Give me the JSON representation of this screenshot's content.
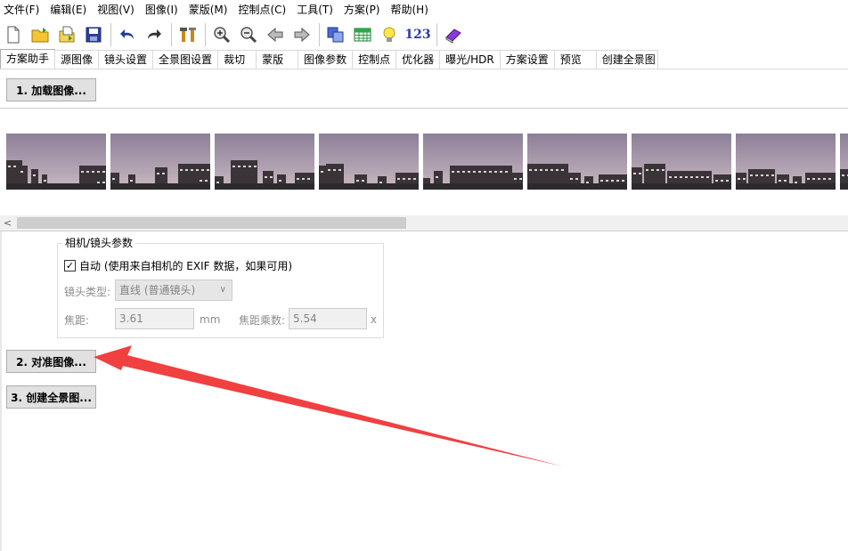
{
  "menubar": {
    "items": [
      "文件(F)",
      "编辑(E)",
      "视图(V)",
      "图像(I)",
      "蒙版(M)",
      "控制点(C)",
      "工具(T)",
      "方案(P)",
      "帮助(H)"
    ]
  },
  "toolbar": {
    "icons": [
      "new-file-icon",
      "open-folder-icon",
      "open-recent-icon",
      "save-icon",
      "undo-icon",
      "redo-icon",
      "tools-icon",
      "zoom-in-icon",
      "zoom-out-icon",
      "arrow-left-icon",
      "arrow-right-icon",
      "layers-icon",
      "table-icon",
      "bulb-icon",
      "numbers-icon",
      "book-icon"
    ],
    "numbers_label": "123"
  },
  "tabs": [
    "方案助手",
    "源图像",
    "镜头设置",
    "全景图设置",
    "裁切",
    "蒙版",
    "图像参数",
    "控制点",
    "优化器",
    "曝光/HDR",
    "方案设置",
    "预览",
    "创建全景图"
  ],
  "buttons": {
    "load": "1. 加载图像...",
    "align": "2. 对准图像...",
    "create": "3. 创建全景图..."
  },
  "camera": {
    "group_title": "相机/镜头参数",
    "auto_label": "自动 (使用来自相机的 EXIF 数据，如果可用)",
    "auto_checked": true,
    "lens_type_label": "镜头类型:",
    "lens_type_value": "直线 (普通镜头)",
    "focal_label": "焦距:",
    "focal_value": "3.61",
    "focal_unit": "mm",
    "crop_label": "焦距乘数:",
    "crop_value": "5.54",
    "crop_unit": "x"
  },
  "colors": {
    "arrow": "#f04040",
    "sky_top": "#8c7f98",
    "sky_bottom": "#c9b9c2"
  },
  "thumbnails_count": 8
}
